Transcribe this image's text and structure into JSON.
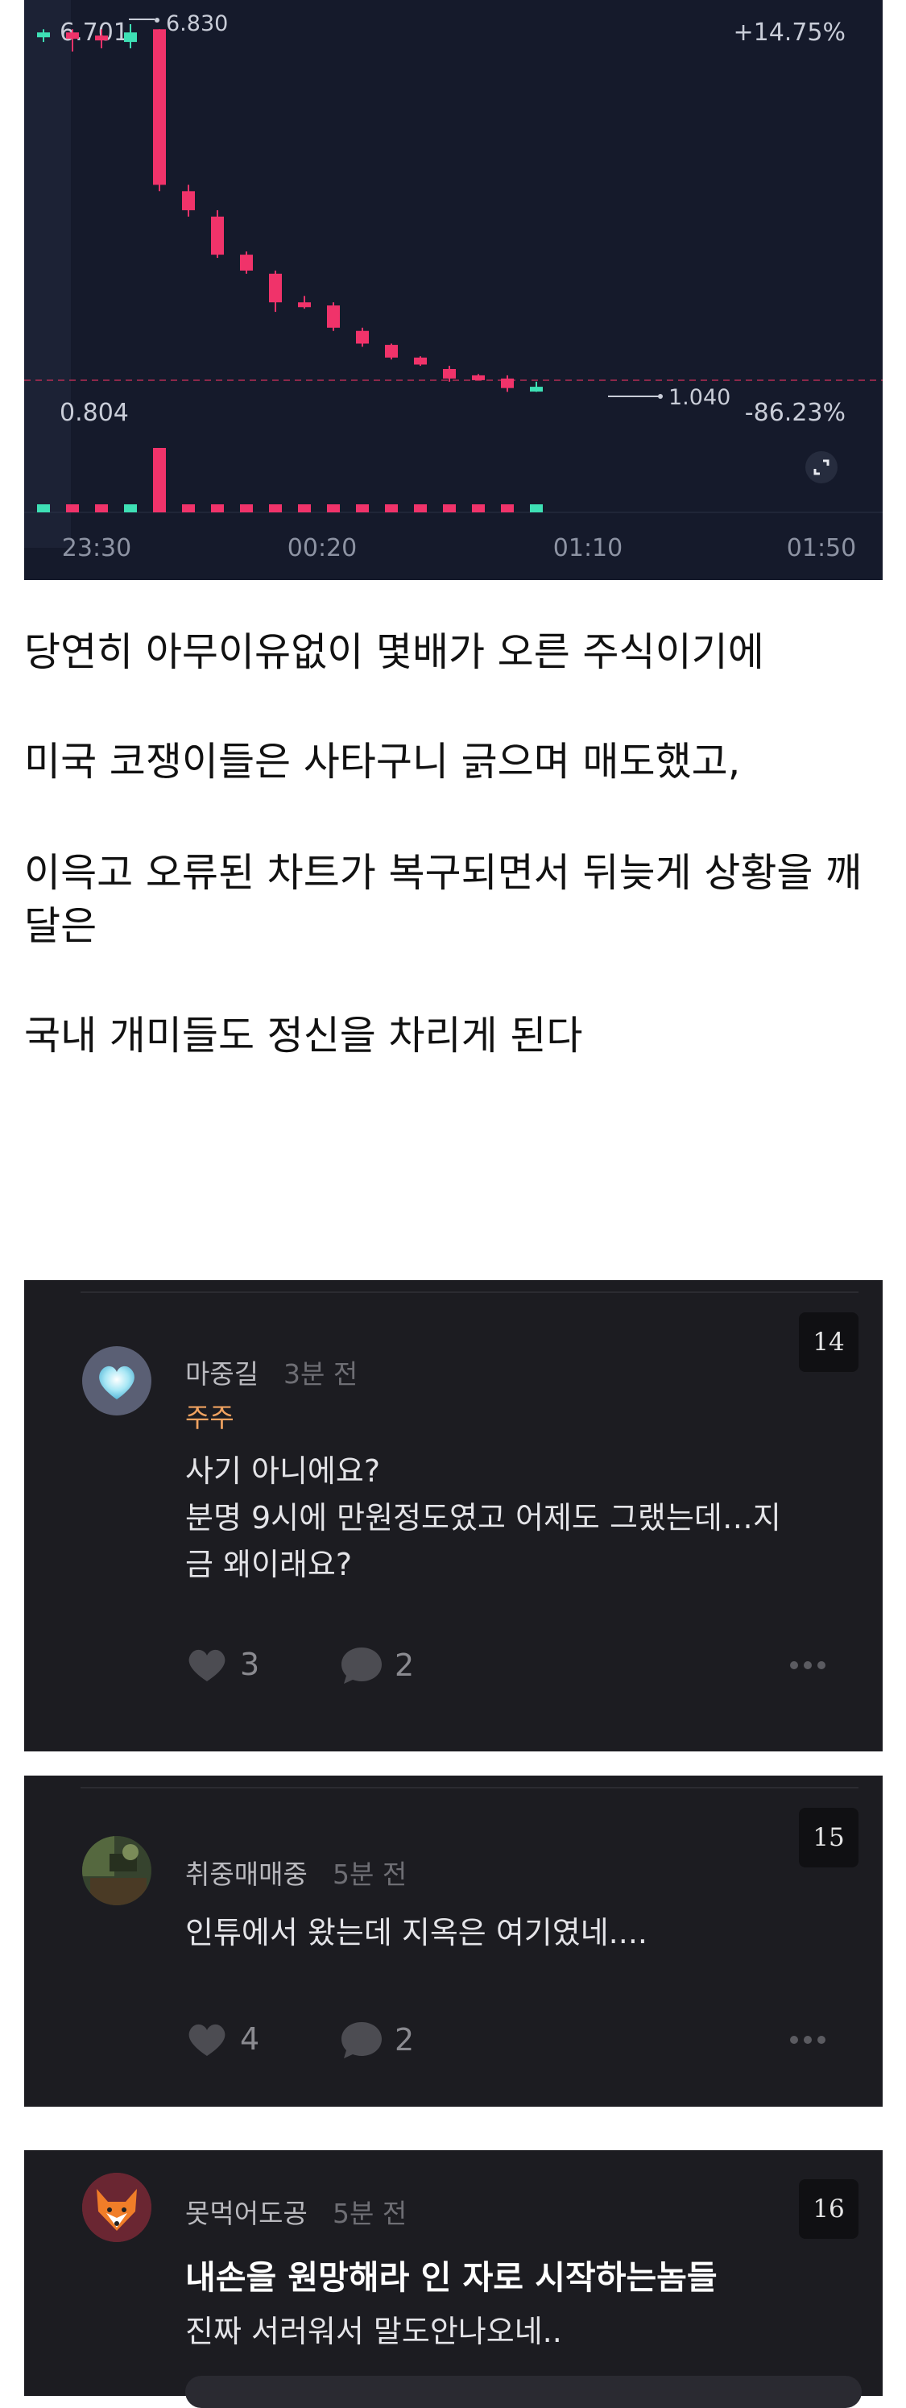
{
  "chart": {
    "price_high_left": "6.701",
    "price_high_right": "6.830",
    "change_top": "+14.75%",
    "price_low": "0.804",
    "price_last": "1.040",
    "change_bottom": "-86.23%",
    "time_labels": [
      "23:30",
      "00:20",
      "01:10",
      "01:50"
    ],
    "colors": {
      "background": "#151a2b",
      "up": "#3ee0b5",
      "down": "#f0336a"
    }
  },
  "chart_data": {
    "type": "candlestick",
    "x": [
      "23:30",
      "",
      "",
      "",
      "",
      "00:20",
      "",
      "",
      "",
      "",
      "",
      "",
      "01:10",
      "",
      "",
      "",
      "",
      "01:50"
    ],
    "ohlc_note": "values read approximately from axes",
    "candles": [
      {
        "o": 6.7,
        "h": 6.75,
        "l": 6.55,
        "c": 6.68,
        "dir": "up"
      },
      {
        "o": 6.7,
        "h": 6.75,
        "l": 6.4,
        "c": 6.6,
        "dir": "down"
      },
      {
        "o": 6.65,
        "h": 6.75,
        "l": 6.45,
        "c": 6.6,
        "dir": "down"
      },
      {
        "o": 6.55,
        "h": 6.83,
        "l": 6.45,
        "c": 6.7,
        "dir": "up"
      },
      {
        "o": 6.75,
        "h": 6.75,
        "l": 4.2,
        "c": 4.3,
        "dir": "down"
      },
      {
        "o": 4.2,
        "h": 4.3,
        "l": 3.8,
        "c": 3.9,
        "dir": "down"
      },
      {
        "o": 3.8,
        "h": 3.9,
        "l": 3.15,
        "c": 3.2,
        "dir": "down"
      },
      {
        "o": 3.2,
        "h": 3.25,
        "l": 2.9,
        "c": 2.95,
        "dir": "down"
      },
      {
        "o": 2.9,
        "h": 2.95,
        "l": 2.3,
        "c": 2.45,
        "dir": "down"
      },
      {
        "o": 2.45,
        "h": 2.55,
        "l": 2.35,
        "c": 2.42,
        "dir": "down"
      },
      {
        "o": 2.4,
        "h": 2.45,
        "l": 2.0,
        "c": 2.05,
        "dir": "down"
      },
      {
        "o": 2.0,
        "h": 2.05,
        "l": 1.75,
        "c": 1.8,
        "dir": "down"
      },
      {
        "o": 1.78,
        "h": 1.8,
        "l": 1.55,
        "c": 1.58,
        "dir": "down"
      },
      {
        "o": 1.58,
        "h": 1.6,
        "l": 1.45,
        "c": 1.47,
        "dir": "down"
      },
      {
        "o": 1.4,
        "h": 1.45,
        "l": 1.2,
        "c": 1.25,
        "dir": "down"
      },
      {
        "o": 1.3,
        "h": 1.32,
        "l": 1.25,
        "c": 1.28,
        "dir": "down"
      },
      {
        "o": 1.25,
        "h": 1.3,
        "l": 1.04,
        "c": 1.1,
        "dir": "down"
      },
      {
        "o": 1.1,
        "h": 1.2,
        "l": 1.04,
        "c": 1.12,
        "dir": "up"
      }
    ],
    "ylim": [
      0.804,
      6.83
    ]
  },
  "post": {
    "line1": "당연히 아무이유없이 몇배가 오른 주식이기에",
    "line2": "미국 코쟁이들은 사타구니 긁으며 매도했고,",
    "line3a": "이윽고 오류된 차트가 복구되면서 뒤늦게 상황을 깨",
    "line3b": "달은",
    "line4": "국내 개미들도 정신을 차리게 된다"
  },
  "comments": [
    {
      "number": "14",
      "author": "마중길",
      "time": "3분 전",
      "flair": "주주",
      "body": [
        "사기 아니에요?",
        "분명 9시에 만원정도였고 어제도 그랬는데…지",
        "금 왜이래요?"
      ],
      "likes": "3",
      "replies": "2"
    },
    {
      "number": "15",
      "author": "취중매매중",
      "time": "5분 전",
      "body": [
        "인튜에서 왔는데 지옥은 여기였네...."
      ],
      "likes": "4",
      "replies": "2"
    },
    {
      "number": "16",
      "author": "못먹어도공",
      "time": "5분 전",
      "title": "내손을 원망해라 인 자로 시작하는놈들",
      "body": [
        "진짜 서러워서 말도안나오네.."
      ]
    }
  ]
}
